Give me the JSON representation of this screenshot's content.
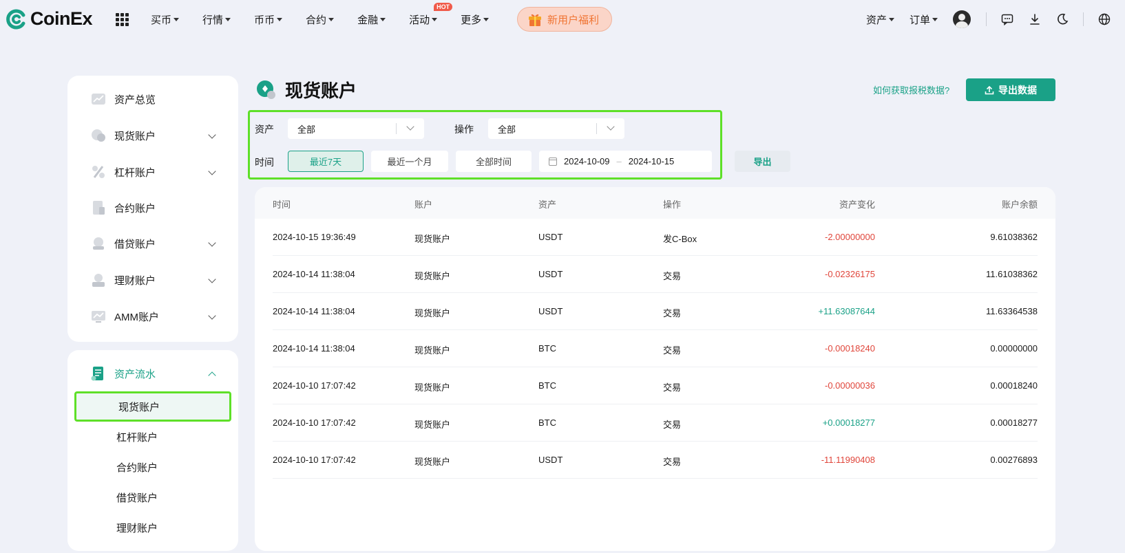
{
  "header": {
    "logo_text": "CoinEx",
    "nav": [
      {
        "label": "买币"
      },
      {
        "label": "行情"
      },
      {
        "label": "币币"
      },
      {
        "label": "合约"
      },
      {
        "label": "金融"
      },
      {
        "label": "活动",
        "badge": "HOT"
      },
      {
        "label": "更多"
      }
    ],
    "promo_label": "新用户福利",
    "assets_label": "资产",
    "orders_label": "订单"
  },
  "sidebar": {
    "main_items": [
      {
        "label": "资产总览"
      },
      {
        "label": "现货账户"
      },
      {
        "label": "杠杆账户"
      },
      {
        "label": "合约账户"
      },
      {
        "label": "借贷账户"
      },
      {
        "label": "理财账户"
      },
      {
        "label": "AMM账户"
      }
    ],
    "flow_section": {
      "label": "资产流水",
      "sub_items": [
        {
          "label": "现货账户",
          "active": true
        },
        {
          "label": "杠杆账户"
        },
        {
          "label": "合约账户"
        },
        {
          "label": "借贷账户"
        },
        {
          "label": "理财账户"
        }
      ]
    }
  },
  "page": {
    "title": "现货账户",
    "tax_link": "如何获取报税数据?",
    "export_data_label": "导出数据"
  },
  "filters": {
    "asset_label": "资产",
    "asset_value": "全部",
    "op_label": "操作",
    "op_value": "全部",
    "time_label": "时间",
    "time_options": [
      "最近7天",
      "最近一个月",
      "全部时间"
    ],
    "time_selected": "最近7天",
    "date_from": "2024-10-09",
    "date_sep": "–",
    "date_to": "2024-10-15",
    "export_label": "导出"
  },
  "table": {
    "columns": [
      "时间",
      "账户",
      "资产",
      "操作",
      "资产变化",
      "账户余额"
    ],
    "rows": [
      {
        "time": "2024-10-15 19:36:49",
        "account": "现货账户",
        "asset": "USDT",
        "op": "发C-Box",
        "change": "-2.00000000",
        "balance": "9.61038362",
        "dir": "neg"
      },
      {
        "time": "2024-10-14 11:38:04",
        "account": "现货账户",
        "asset": "USDT",
        "op": "交易",
        "change": "-0.02326175",
        "balance": "11.61038362",
        "dir": "neg"
      },
      {
        "time": "2024-10-14 11:38:04",
        "account": "现货账户",
        "asset": "USDT",
        "op": "交易",
        "change": "+11.63087644",
        "balance": "11.63364538",
        "dir": "pos"
      },
      {
        "time": "2024-10-14 11:38:04",
        "account": "现货账户",
        "asset": "BTC",
        "op": "交易",
        "change": "-0.00018240",
        "balance": "0.00000000",
        "dir": "neg"
      },
      {
        "time": "2024-10-10 17:07:42",
        "account": "现货账户",
        "asset": "BTC",
        "op": "交易",
        "change": "-0.00000036",
        "balance": "0.00018240",
        "dir": "neg"
      },
      {
        "time": "2024-10-10 17:07:42",
        "account": "现货账户",
        "asset": "BTC",
        "op": "交易",
        "change": "+0.00018277",
        "balance": "0.00018277",
        "dir": "pos"
      },
      {
        "time": "2024-10-10 17:07:42",
        "account": "现货账户",
        "asset": "USDT",
        "op": "交易",
        "change": "-11.11990408",
        "balance": "0.00276893",
        "dir": "neg"
      }
    ]
  },
  "colors": {
    "accent": "#1aa187",
    "negative": "#e0453a",
    "highlight": "#5ee028",
    "promo": "#f07534"
  }
}
